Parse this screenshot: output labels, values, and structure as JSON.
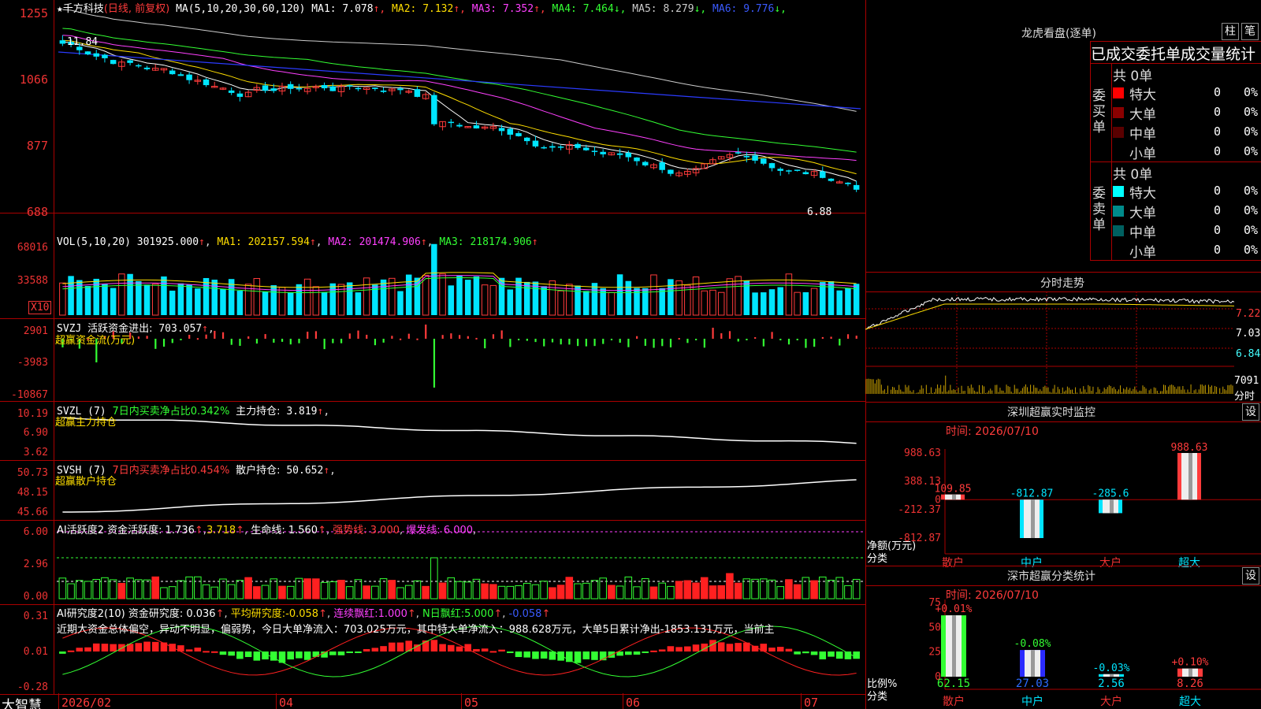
{
  "app": {
    "brand": "大智慧"
  },
  "kline": {
    "title_star": "★",
    "name": "千方科技",
    "mode": "(日线, 前复权)",
    "ma_params": "MA(5,10,20,30,60,120)",
    "ma": [
      {
        "label": "MA1:",
        "value": "7.078",
        "arrow": "↑",
        "color": "#ffffff"
      },
      {
        "label": "MA2:",
        "value": "7.132",
        "arrow": "↑",
        "color": "#ffde00"
      },
      {
        "label": "MA3:",
        "value": "7.352",
        "arrow": "↑",
        "color": "#ff40ff"
      },
      {
        "label": "MA4:",
        "value": "7.464",
        "arrow": "↓",
        "color": "#33ff33"
      },
      {
        "label": "MA5:",
        "value": "8.279",
        "arrow": "↓",
        "color": "#cccccc"
      },
      {
        "label": "MA6:",
        "value": "9.776",
        "arrow": "↓",
        "color": "#3b5bff"
      }
    ],
    "y_ticks": [
      "1255",
      "1066",
      "877",
      "688"
    ],
    "high_label": "11.84",
    "low_label": "6.88"
  },
  "vol": {
    "header": "VOL(5,10,20)",
    "value": "301925.000",
    "ma1": "202157.594",
    "ma2": "201474.906",
    "ma3": "218174.906",
    "y_ticks": [
      "68016",
      "33588"
    ],
    "unit": "X10"
  },
  "svzj": {
    "header": "SVZJ",
    "label": "活跃资金进出:",
    "value": "703.057",
    "sub": "超赢资金流(万元)",
    "y_ticks": [
      "2901",
      "-3983",
      "-10867"
    ]
  },
  "svzl": {
    "header": "SVZL (7)",
    "ratio_label": "7日内买卖净占比0.342%",
    "hold_label": "主力持仓:",
    "hold_value": "3.819",
    "sub": "超赢主力持仓",
    "y_ticks": [
      "10.19",
      "6.90",
      "3.62"
    ]
  },
  "svsh": {
    "header": "SVSH (7)",
    "ratio_label": "7日内买卖净占比0.454%",
    "hold_label": "散户持仓:",
    "hold_value": "50.652",
    "sub": "超赢散户持仓",
    "y_ticks": [
      "50.73",
      "48.15",
      "45.66"
    ]
  },
  "ai_active": {
    "header": "AI活跃度2",
    "l1": "资金活跃度:",
    "v1": "1.736",
    "v2": "3.718",
    "l3": "生命线:",
    "v3": "1.560",
    "l4": "强势线:",
    "v4": "3.000",
    "l5": "爆发线:",
    "v5": "6.000",
    "y_ticks": [
      "6.00",
      "2.96",
      "0.00"
    ]
  },
  "ai_research": {
    "header": "AI研究度2(10)",
    "l1": "资金研究度:",
    "v1": "0.036",
    "l2": "平均研究度:",
    "v2": "-0.058",
    "l3": "连续飘红:",
    "v3": "1.000",
    "l4": "N日飘红:",
    "v4": "5.000",
    "v5": "-0.058",
    "commentary": "近期大资金总体偏空，异动不明显，偏弱势，今日大单净流入：703.025万元，其中特大单净流入：988.628万元，大单5日累计净出-1853.131万元，当前主",
    "y_ticks": [
      "0.31",
      "0.01",
      "-0.28"
    ]
  },
  "x_axis": [
    "2026/02",
    "04",
    "05",
    "06",
    "07"
  ],
  "dragon": {
    "title": "龙虎看盘(逐单)",
    "btn1": "柱",
    "btn2": "笔",
    "subtitle": "已成交委托单成交量统计",
    "buy_label": "委买单",
    "sell_label": "委卖单",
    "buy_total": "共 0单",
    "sell_total": "共 0单",
    "rows_buy": [
      {
        "name": "特大",
        "count": "0",
        "pct": "0%",
        "color": "#ff0000"
      },
      {
        "name": "大单",
        "count": "0",
        "pct": "0%",
        "color": "#8b0000"
      },
      {
        "name": "中单",
        "count": "0",
        "pct": "0%",
        "color": "#5a0000"
      },
      {
        "name": "小单",
        "count": "0",
        "pct": "0%",
        "color": "#000000"
      }
    ],
    "rows_sell": [
      {
        "name": "特大",
        "count": "0",
        "pct": "0%",
        "color": "#00ffff"
      },
      {
        "name": "大单",
        "count": "0",
        "pct": "0%",
        "color": "#008b8b"
      },
      {
        "name": "中单",
        "count": "0",
        "pct": "0%",
        "color": "#006060"
      },
      {
        "name": "小单",
        "count": "0",
        "pct": "0%",
        "color": "#000000"
      }
    ]
  },
  "intraday": {
    "title": "分时走势",
    "y_ticks": [
      "7.22",
      "7.03",
      "6.84"
    ],
    "vol_tick": "7091",
    "vol_label": "分时"
  },
  "monitor": {
    "title": "深圳超赢实时监控",
    "set": "设",
    "time_label": "时间: 2026/07/10",
    "y_ticks": [
      "988.63",
      "388.13",
      "0",
      "-212.37",
      "-812.87"
    ],
    "axis_label": "净额(万元)",
    "axis_label2": "分类",
    "chart_data": {
      "type": "bar",
      "categories": [
        "散户",
        "中户",
        "大户",
        "超大"
      ],
      "values": [
        109.85,
        -812.87,
        -285.6,
        988.63
      ],
      "labels": [
        "109.85",
        "-812.87",
        "-285.6",
        "988.63"
      ],
      "ylim": [
        -812.87,
        988.63
      ]
    }
  },
  "classify": {
    "title": "深市超赢分类统计",
    "set": "设",
    "time_label": "时间: 2026/07/10",
    "y_ticks": [
      "75",
      "50",
      "25",
      "0"
    ],
    "axis_label": "比例%",
    "axis_label2": "分类",
    "chart_data": {
      "type": "bar",
      "categories": [
        "散户",
        "中户",
        "大户",
        "超大"
      ],
      "values": [
        62.15,
        27.03,
        2.56,
        8.26
      ],
      "value_labels": [
        "62.15",
        "27.03",
        "2.56",
        "8.26"
      ],
      "change_labels": [
        "+0.01%",
        "-0.08%",
        "-0.03%",
        "+0.10%"
      ],
      "ylim": [
        0,
        75
      ]
    }
  },
  "colors": {
    "up": "#ff3b3b",
    "down": "#00e5ff",
    "grid": "#aa0000"
  }
}
